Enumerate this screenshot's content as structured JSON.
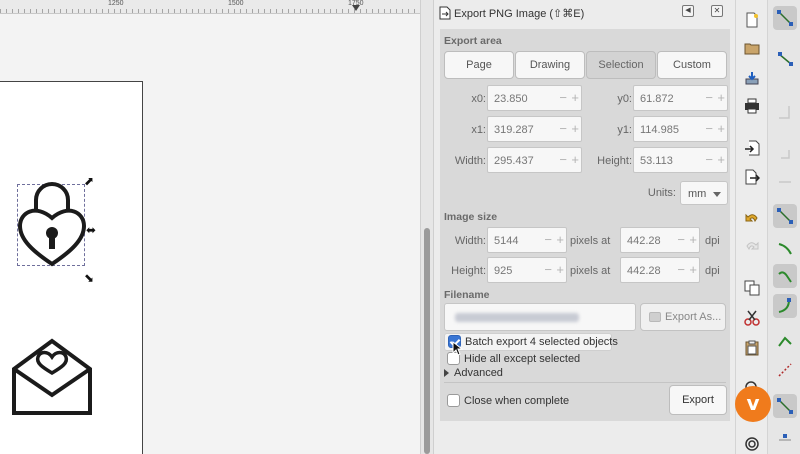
{
  "ruler": {
    "labels": [
      "1250",
      "1500",
      "1750"
    ]
  },
  "dialog": {
    "title": "Export PNG Image (⇧⌘E)",
    "export_area": {
      "heading": "Export area",
      "buttons": [
        "Page",
        "Drawing",
        "Selection",
        "Custom"
      ],
      "active": "Selection",
      "x0": {
        "label": "x0:",
        "value": "23.850"
      },
      "y0": {
        "label": "y0:",
        "value": "61.872"
      },
      "x1": {
        "label": "x1:",
        "value": "319.287"
      },
      "y1": {
        "label": "y1:",
        "value": "114.985"
      },
      "width": {
        "label": "Width:",
        "value": "295.437"
      },
      "height": {
        "label": "Height:",
        "value": "53.113"
      },
      "units_label": "Units:",
      "units_value": "mm"
    },
    "image_size": {
      "heading": "Image size",
      "width_label": "Width:",
      "width_value": "5144",
      "height_label": "Height:",
      "height_value": "925",
      "pixels_at_1": "pixels at",
      "pixels_at_2": "pixels at",
      "dpi_1": "442.28",
      "dpi_2": "442.28",
      "dpi_unit_1": "dpi",
      "dpi_unit_2": "dpi"
    },
    "filename": {
      "heading": "Filename",
      "export_as_label": "Export As..."
    },
    "batch_export_label": "Batch export 4 selected objects",
    "batch_export_checked": true,
    "hide_all_label": "Hide all except selected",
    "hide_all_checked": false,
    "advanced_label": "Advanced",
    "close_when_complete_label": "Close when complete",
    "close_when_complete_checked": false,
    "export_label": "Export"
  },
  "colors": {
    "accent_blue": "#3a76d4",
    "vimeo_orange": "#f07b1c"
  },
  "toolbar_a_icons": [
    "new-document-icon",
    "open-folder-icon",
    "import-icon",
    "print-icon",
    "import-arrow-icon",
    "export-doc-icon",
    "undo-icon",
    "redo-icon",
    "duplicate-icon",
    "cut-icon",
    "paste-icon",
    "zoom-icon",
    "zoom-icon-2"
  ],
  "toolbar_b_icons": [
    "snap-nodes-icon",
    "snap-node-icon",
    "snap-bbox-icon",
    "snap-corner-icon",
    "snap-midpoint-icon",
    "snap-path-icon",
    "snap-curve-icon",
    "snap-smooth-icon",
    "snap-angle-icon",
    "snap-center-icon",
    "snap-intersect-icon",
    "snap-page-icon"
  ]
}
